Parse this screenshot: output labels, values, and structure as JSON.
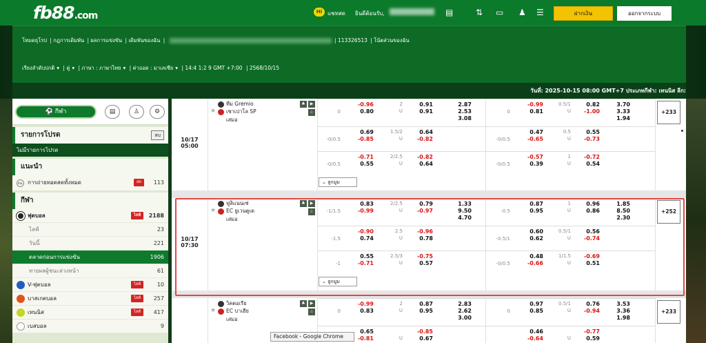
{
  "header": {
    "logo_text": "fb88",
    "logo_suffix": ".com",
    "chat_icon_text": "Hi",
    "chat_label": "แชทสด",
    "welcome": "ยินดีต้อนรับ,",
    "deposit_label": "ฝากเงิน",
    "logout_label": "ออกจากระบบ"
  },
  "nav": {
    "row1": [
      "โหมดยุโรป",
      "กฎการเดิมพัน",
      "ผลการแข่งขัน",
      "เดิมพันของฉัน"
    ],
    "account_id": "113326513",
    "my_notes": "โน้ตส่วนของฉัน",
    "sort": "เรียงลำดับปกติ",
    "pair": "คู่",
    "language": "ภาษา : ภาษาไทย",
    "odds": "ค่าออด : มาเลเซีย",
    "timezone": "14:4 1:2 9 GMT +7:00",
    "thai_date": "2568/10/15",
    "date_bar": "วันที่: 2025-10-15 08:00 GMT+7 ประเภทกีฬา: เทนนิส ลีก:"
  },
  "sidebar": {
    "sport_tab": "กีฬา",
    "fav_title": "รายการโปรด",
    "fav_clear": "ลบ",
    "fav_empty": "ไม่มีรายการโปรด",
    "rec_title": "แนะนำ",
    "rec_all_badge": "ALL",
    "rec_live_label": "การถ่ายทอดสดทั้งหมด",
    "rec_live_badge": "สด",
    "rec_live_count": "113",
    "sports_title": "กีฬา",
    "football": {
      "label": "ฟุตบอล",
      "badge": "ไลฟ์",
      "count": "2188"
    },
    "sub": [
      {
        "label": "ไลฟ์",
        "count": "23"
      },
      {
        "label": "วันนี้",
        "count": "221"
      },
      {
        "label": "ตลาดก่อนการแข่งขัน",
        "count": "1906"
      },
      {
        "label": "ทายผลผู้ชนะล่วงหน้า",
        "count": "61"
      }
    ],
    "others": [
      {
        "label": "V-ฟุตบอล",
        "badge": "ไลฟ์",
        "count": "10"
      },
      {
        "label": "บาสเกตบอล",
        "badge": "ไลฟ์",
        "count": "257"
      },
      {
        "label": "เทนนิส",
        "badge": "ไลฟ์",
        "count": "417"
      },
      {
        "label": "เบสบอล",
        "badge": "",
        "count": "9"
      }
    ]
  },
  "matches": [
    {
      "date": "10/17",
      "time": "05:00",
      "home": "ทีม Gremio",
      "away": "เซาเปาโล SP",
      "draw": "เสมอ",
      "more": "ลูกมูม",
      "plus": "+233",
      "lines": [
        {
          "h": "0",
          "ho": [
            "-0.96",
            "0.80"
          ],
          "ou": [
            "2",
            "U"
          ],
          "ouo": [
            "0.91",
            "0.91"
          ],
          "x12": [
            "2.87",
            "2.53",
            "3.08"
          ],
          "h2": "0",
          "h2o": [
            "-0.99",
            "0.81"
          ],
          "ou2": [
            "0.5/1",
            "U"
          ],
          "ou2o": [
            "0.82",
            "-1.00"
          ],
          "x12b": [
            "3.70",
            "3.33",
            "1.94"
          ]
        },
        {
          "h": "-0/0.5",
          "ho": [
            "0.69",
            "-0.85"
          ],
          "ou": [
            "1.5/2",
            "U"
          ],
          "ouo": [
            "0.64",
            "-0.82"
          ],
          "h2": "-0/0.5",
          "h2o": [
            "0.47",
            "-0.65"
          ],
          "ou2": [
            "0.5",
            "U"
          ],
          "ou2o": [
            "0.55",
            "-0.73"
          ]
        },
        {
          "h": "-0/0.5",
          "ho": [
            "-0.71",
            "0.55"
          ],
          "ou": [
            "2/2.5",
            "U"
          ],
          "ouo": [
            "-0.82",
            "0.64"
          ],
          "h2": "-0/0.5",
          "h2o": [
            "-0.57",
            "0.39"
          ],
          "ou2": [
            "1",
            "U"
          ],
          "ou2o": [
            "-0.72",
            "0.54"
          ]
        }
      ]
    },
    {
      "date": "10/17",
      "time": "07:30",
      "home": "ฟูลิแนนเซ่",
      "away": "EC ยูเวนตูเด",
      "draw": "เสมอ",
      "more": "ลูกมูม",
      "plus": "+252",
      "lines": [
        {
          "h": "-1/1.5",
          "ho": [
            "0.83",
            "-0.99"
          ],
          "ou": [
            "2/2.5",
            "U"
          ],
          "ouo": [
            "0.79",
            "-0.97"
          ],
          "x12": [
            "1.33",
            "9.50",
            "4.70"
          ],
          "h2": "-0.5",
          "h2o": [
            "0.87",
            "0.95"
          ],
          "ou2": [
            "1",
            "U"
          ],
          "ou2o": [
            "0.96",
            "0.86"
          ],
          "x12b": [
            "1.85",
            "8.50",
            "2.30"
          ]
        },
        {
          "h": "-1.5",
          "ho": [
            "-0.90",
            "0.74"
          ],
          "ou": [
            "2.5",
            "U"
          ],
          "ouo": [
            "-0.96",
            "0.78"
          ],
          "h2": "-0.5/1",
          "h2o": [
            "0.60",
            "0.62"
          ],
          "ou2": [
            "0.5/1",
            "U"
          ],
          "ou2o": [
            "0.56",
            "-0.74"
          ]
        },
        {
          "h": "-1",
          "ho": [
            "0.55",
            "-0.71"
          ],
          "ou": [
            "2.5/3",
            "U"
          ],
          "ouo": [
            "-0.75",
            "0.57"
          ],
          "h2": "-0/0.5",
          "h2o": [
            "0.48",
            "-0.66"
          ],
          "ou2": [
            "1/1.5",
            "U"
          ],
          "ou2o": [
            "-0.69",
            "0.51"
          ]
        }
      ]
    },
    {
      "date": "",
      "time": "",
      "home": "วิคตอเรีย",
      "away": "EC บาเฮีย",
      "draw": "เสมอ",
      "plus": "+233",
      "lines": [
        {
          "h": "0",
          "ho": [
            "-0.99",
            "0.83"
          ],
          "ou": [
            "2",
            "U"
          ],
          "ouo": [
            "0.87",
            "0.95"
          ],
          "x12": [
            "2.83",
            "2.62",
            "3.00"
          ],
          "h2": "0",
          "h2o": [
            "0.97",
            "0.85"
          ],
          "ou2": [
            "0.5/1",
            "U"
          ],
          "ou2o": [
            "0.76",
            "-0.94"
          ],
          "x12b": [
            "3.53",
            "3.36",
            "1.98"
          ]
        },
        {
          "h": "",
          "ho": [
            "0.65",
            "-0.81"
          ],
          "ou": [
            "",
            "U"
          ],
          "ouo": [
            "-0.85",
            "0.67"
          ],
          "h2": "",
          "h2o": [
            "0.46",
            "-0.64"
          ],
          "ou2": [
            "",
            "U"
          ],
          "ou2o": [
            "-0.77",
            "0.59"
          ]
        }
      ]
    }
  ],
  "tooltip": "Facebook - Google Chrome",
  "colors": {
    "brand_green": "#0b7a2a",
    "deposit_yellow": "#f2c300",
    "negative_red": "#dd1111",
    "highlight_red": "#e04848"
  }
}
